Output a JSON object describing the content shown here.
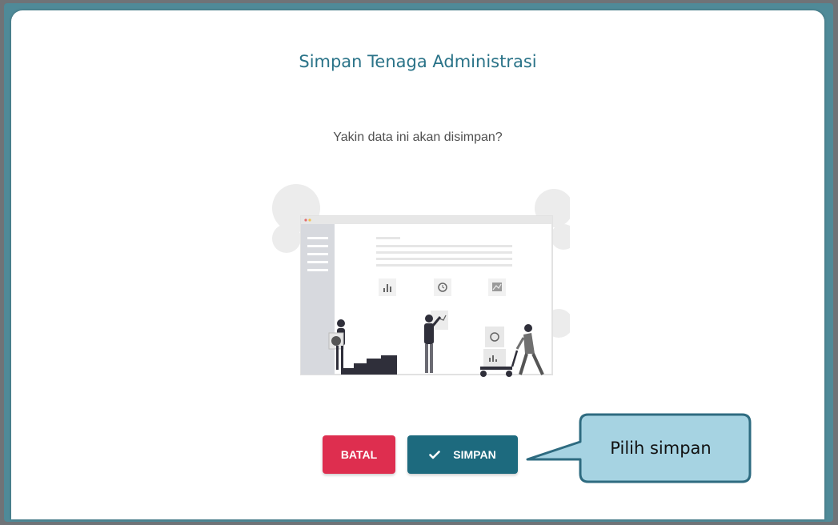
{
  "dialog": {
    "title": "Simpan Tenaga Administrasi",
    "message": "Yakin data ini akan disimpan?",
    "cancel_label": "BATAL",
    "save_label": "SIMPAN",
    "save_icon": "check-icon",
    "illustration": "people-building-dashboard-illustration"
  },
  "callout": {
    "text": "Pilih simpan"
  },
  "colors": {
    "title": "#2a7388",
    "cancel_button": "#de2e4f",
    "save_button": "#1d6a7e",
    "callout_fill": "#a6d3e2",
    "callout_border": "#2e6b80"
  }
}
